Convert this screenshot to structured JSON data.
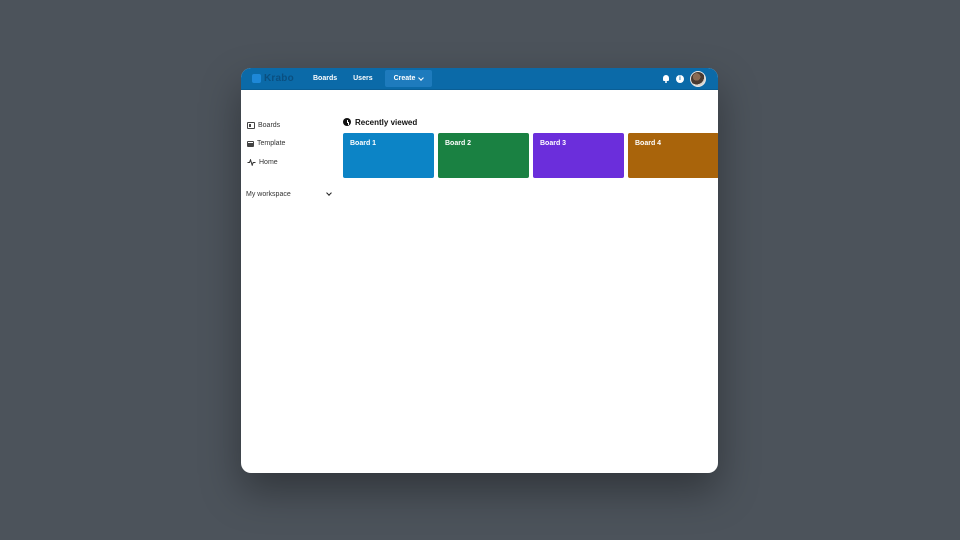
{
  "app": {
    "logo_text": "Krabo"
  },
  "topbar": {
    "nav": [
      {
        "label": "Boards"
      },
      {
        "label": "Users"
      },
      {
        "label": "Create"
      }
    ]
  },
  "sidebar": {
    "items": [
      {
        "label": "Boards",
        "icon": "board-icon"
      },
      {
        "label": "Template",
        "icon": "template-icon"
      },
      {
        "label": "Home",
        "icon": "home-icon"
      }
    ],
    "workspace_label": "My workspace"
  },
  "main": {
    "section_title": "Recently viewed",
    "boards": [
      {
        "title": "Board 1",
        "color": "#0c84c6"
      },
      {
        "title": "Board 2",
        "color": "#1a8142"
      },
      {
        "title": "Board 3",
        "color": "#6b2edb"
      },
      {
        "title": "Board 4",
        "color": "#a9640b"
      }
    ]
  },
  "colors": {
    "topbar": "#0b6aa8",
    "background": "#4c535b"
  }
}
